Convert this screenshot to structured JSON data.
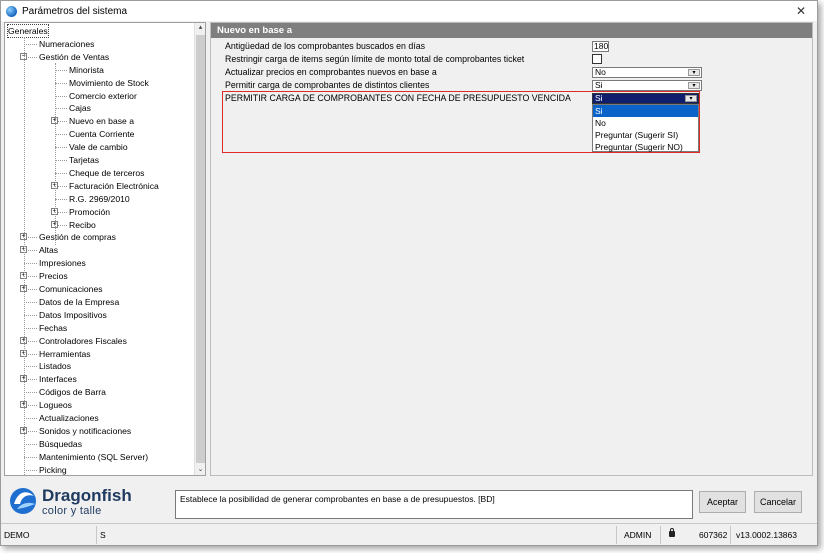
{
  "window": {
    "title": "Parámetros del sistema",
    "close_glyph": "✕"
  },
  "tree": {
    "items": [
      {
        "label": "Generales",
        "level": 0,
        "expander": "",
        "selected": true
      },
      {
        "label": "Numeraciones",
        "level": 1,
        "expander": ""
      },
      {
        "label": "Gestión de Ventas",
        "level": 1,
        "expander": "−"
      },
      {
        "label": "Minorista",
        "level": 2,
        "expander": ""
      },
      {
        "label": "Movimiento de Stock",
        "level": 2,
        "expander": ""
      },
      {
        "label": "Comercio exterior",
        "level": 2,
        "expander": ""
      },
      {
        "label": "Cajas",
        "level": 2,
        "expander": ""
      },
      {
        "label": "Nuevo en base a",
        "level": 2,
        "expander": "+",
        "current": true
      },
      {
        "label": "Cuenta Corriente",
        "level": 2,
        "expander": ""
      },
      {
        "label": "Vale de cambio",
        "level": 2,
        "expander": ""
      },
      {
        "label": "Tarjetas",
        "level": 2,
        "expander": ""
      },
      {
        "label": "Cheque de terceros",
        "level": 2,
        "expander": ""
      },
      {
        "label": "Facturación Electrónica",
        "level": 2,
        "expander": "+"
      },
      {
        "label": "R.G. 2969/2010",
        "level": 2,
        "expander": ""
      },
      {
        "label": "Promoción",
        "level": 2,
        "expander": "+"
      },
      {
        "label": "Recibo",
        "level": 2,
        "expander": "+"
      },
      {
        "label": "Gestión de compras",
        "level": 1,
        "expander": "+"
      },
      {
        "label": "Altas",
        "level": 1,
        "expander": "+"
      },
      {
        "label": "Impresiones",
        "level": 1,
        "expander": ""
      },
      {
        "label": "Precios",
        "level": 1,
        "expander": "+"
      },
      {
        "label": "Comunicaciones",
        "level": 1,
        "expander": "+"
      },
      {
        "label": "Datos de la Empresa",
        "level": 1,
        "expander": ""
      },
      {
        "label": "Datos Impositivos",
        "level": 1,
        "expander": ""
      },
      {
        "label": "Fechas",
        "level": 1,
        "expander": ""
      },
      {
        "label": "Controladores Fiscales",
        "level": 1,
        "expander": "+"
      },
      {
        "label": "Herramientas",
        "level": 1,
        "expander": "+"
      },
      {
        "label": "Listados",
        "level": 1,
        "expander": ""
      },
      {
        "label": "Interfaces",
        "level": 1,
        "expander": "+"
      },
      {
        "label": "Códigos de Barra",
        "level": 1,
        "expander": ""
      },
      {
        "label": "Logueos",
        "level": 1,
        "expander": "+"
      },
      {
        "label": "Actualizaciones",
        "level": 1,
        "expander": ""
      },
      {
        "label": "Sonidos y notificaciones",
        "level": 1,
        "expander": "+"
      },
      {
        "label": "Búsquedas",
        "level": 1,
        "expander": ""
      },
      {
        "label": "Mantenimiento (SQL Server)",
        "level": 1,
        "expander": ""
      },
      {
        "label": "Picking",
        "level": 1,
        "expander": ""
      }
    ],
    "scroll_up": "▴",
    "scroll_down": "⌄"
  },
  "panel": {
    "header": "Nuevo en base a",
    "rows": [
      {
        "label": "Antigüedad de los comprobantes buscados en días",
        "control": "number",
        "value": "180"
      },
      {
        "label": "Restringir carga de items según límite de monto total de comprobantes ticket",
        "control": "checkbox",
        "checked": false
      },
      {
        "label": "Actualizar precios en comprobantes nuevos en base a",
        "control": "combo",
        "value": "No"
      },
      {
        "label": "Permitir carga de comprobantes de distintos clientes",
        "control": "combo",
        "value": "Si"
      },
      {
        "label": "PERMITIR CARGA DE COMPROBANTES CON FECHA DE PRESUPUESTO VENCIDA",
        "control": "combo",
        "value": "Si",
        "open": true
      }
    ],
    "dropdown_options": [
      "Si",
      "No",
      "Preguntar (Sugerir SI)",
      "Preguntar (Sugerir NO)"
    ],
    "dropdown_selected_index": 0,
    "dropdown_arrow": "▾"
  },
  "footer": {
    "logo_title": "Dragonfish",
    "logo_subtitle": "color y talle",
    "description": "Establece la posibilidad de generar comprobantes en base a de presupuestos. [BD]",
    "accept_label": "Aceptar",
    "cancel_label": "Cancelar"
  },
  "statusbar": {
    "db": "DEMO",
    "mode": "S",
    "user": "ADMIN",
    "code": "607362",
    "version": "v13.0002.13863"
  },
  "colors": {
    "header_bg": "#7f7f7f",
    "highlight_border": "#e02b2b",
    "selection_bg": "#0a63c9",
    "brand": "#1f3a5f"
  }
}
